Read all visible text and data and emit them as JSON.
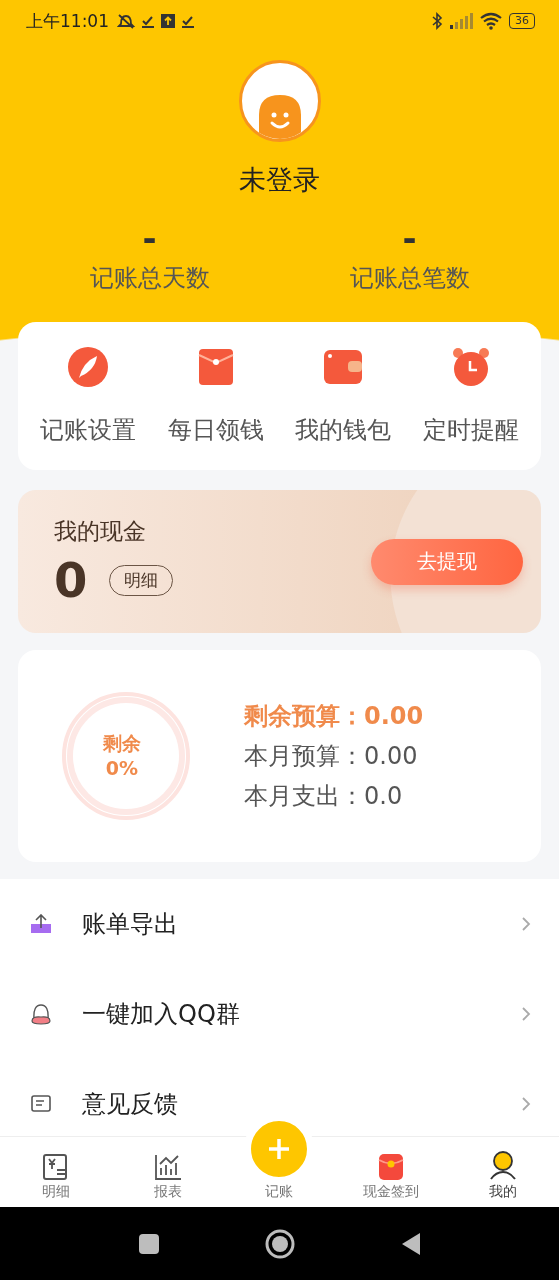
{
  "status_bar": {
    "time": "上午11:01",
    "battery": "36"
  },
  "profile": {
    "name": "未登录"
  },
  "stats": [
    {
      "value": "-",
      "label": "记账总天数"
    },
    {
      "value": "-",
      "label": "记账总笔数"
    }
  ],
  "shortcuts": [
    {
      "kind": "feather",
      "label": "记账设置"
    },
    {
      "kind": "envelope",
      "label": "每日领钱"
    },
    {
      "kind": "wallet",
      "label": "我的钱包"
    },
    {
      "kind": "alarm",
      "label": "定时提醒"
    }
  ],
  "cash": {
    "title": "我的现金",
    "amount": "0",
    "detail_button": "明细",
    "withdraw_button": "去提现"
  },
  "budget": {
    "ring_label": "剩余",
    "ring_percent": "0%",
    "level": 0,
    "lines": [
      {
        "kind": "highlight",
        "label": "剩余预算：",
        "value": "0.00"
      },
      {
        "kind": "normal",
        "label": "本月预算：",
        "value": "0.00"
      },
      {
        "kind": "normal",
        "label": "本月支出：",
        "value": "0.0"
      }
    ]
  },
  "menu": [
    {
      "kind": "export",
      "label": "账单导出"
    },
    {
      "kind": "qq",
      "label": "一键加入QQ群"
    },
    {
      "kind": "feedback",
      "label": "意见反馈"
    }
  ],
  "tabs": [
    {
      "kind": "detail",
      "label": "明细",
      "selected": false
    },
    {
      "kind": "chart",
      "label": "报表",
      "selected": false
    },
    {
      "kind": "add",
      "label": "记账",
      "selected": false
    },
    {
      "kind": "redpacket",
      "label": "现金签到",
      "selected": false
    },
    {
      "kind": "me",
      "label": "我的",
      "selected": true
    }
  ]
}
